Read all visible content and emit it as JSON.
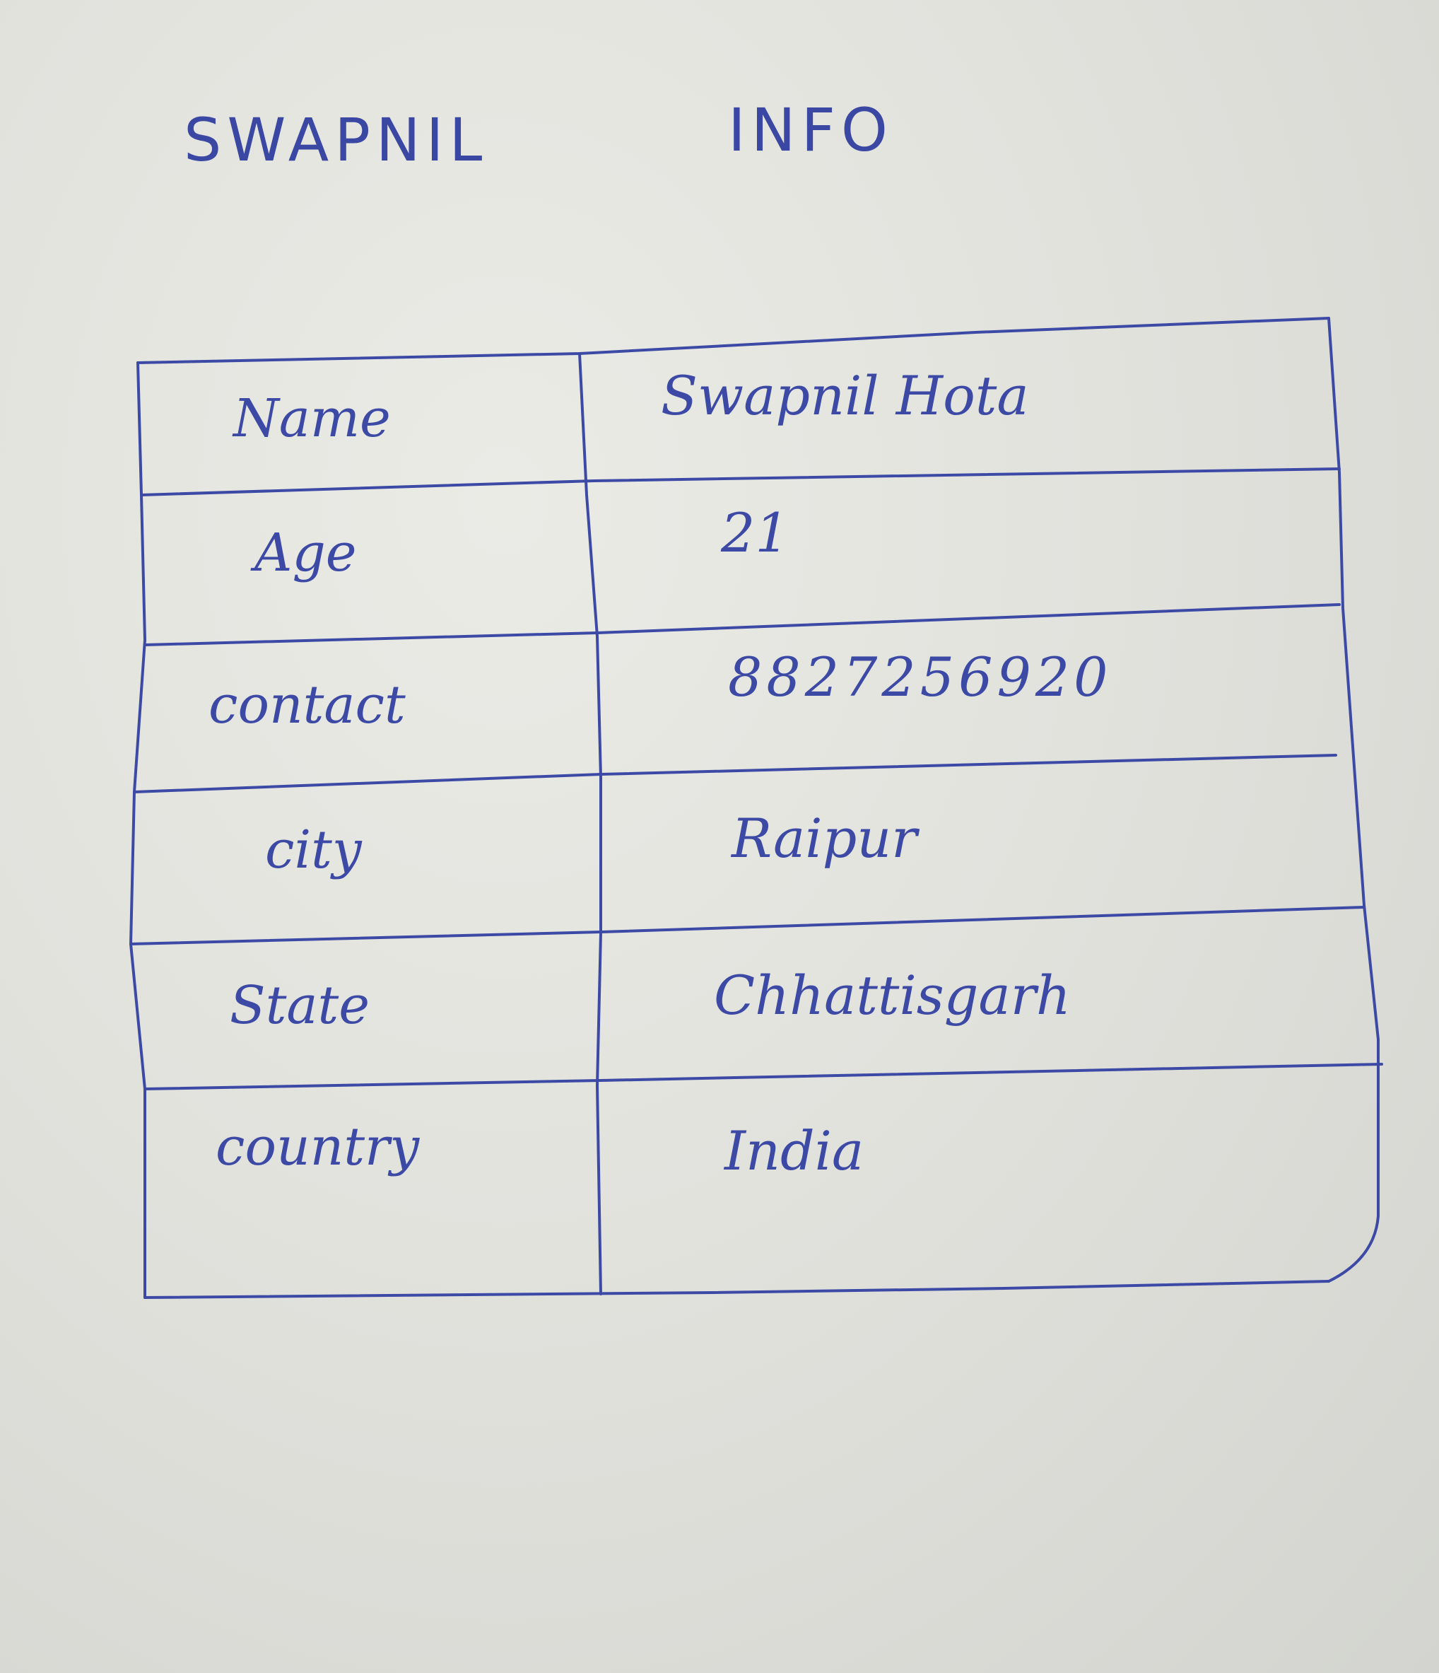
{
  "title": {
    "left": "SWAPNIL",
    "right": "INFO"
  },
  "table": {
    "rows": [
      {
        "label": "Name",
        "value": "Swapnil Hota"
      },
      {
        "label": "Age",
        "value": "21"
      },
      {
        "label": "contact",
        "value": "8827256920"
      },
      {
        "label": "city",
        "value": "Raipur"
      },
      {
        "label": "State",
        "value": "Chhattisgarh"
      },
      {
        "label": "country",
        "value": "India"
      }
    ]
  },
  "ink_color": "#3c4aa6",
  "paper_color": "#e4e4df"
}
